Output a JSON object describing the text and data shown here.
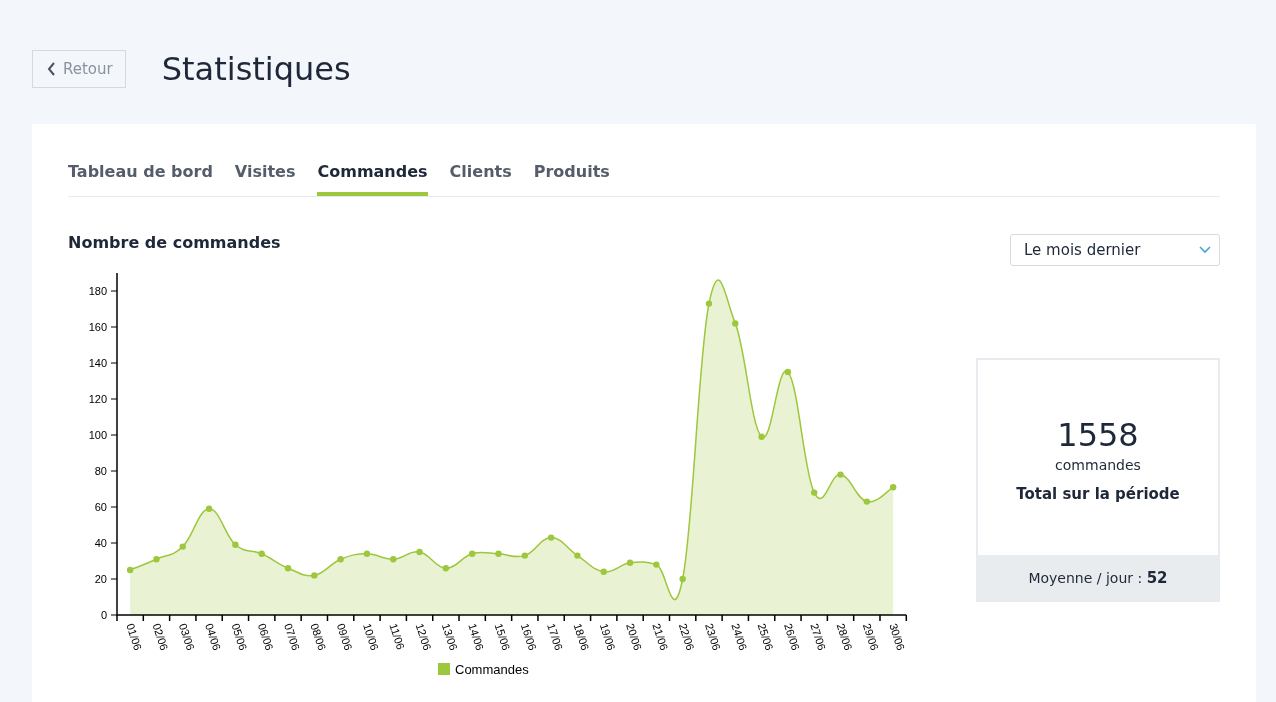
{
  "header": {
    "back_button": "Retour",
    "title": "Statistiques"
  },
  "tabs": [
    {
      "label": "Tableau de bord",
      "selected": false
    },
    {
      "label": "Visites",
      "selected": false
    },
    {
      "label": "Commandes",
      "selected": true
    },
    {
      "label": "Clients",
      "selected": false
    },
    {
      "label": "Produits",
      "selected": false
    }
  ],
  "section_title": "Nombre de commandes",
  "period_select": {
    "value": "Le mois dernier"
  },
  "chart_data": {
    "type": "area",
    "categories": [
      "01/06",
      "02/06",
      "03/06",
      "04/06",
      "05/06",
      "06/06",
      "07/06",
      "08/06",
      "09/06",
      "10/06",
      "11/06",
      "12/06",
      "13/06",
      "14/06",
      "15/06",
      "16/06",
      "17/06",
      "18/06",
      "19/06",
      "20/06",
      "21/06",
      "22/06",
      "23/06",
      "24/06",
      "25/06",
      "26/06",
      "27/06",
      "28/06",
      "29/06",
      "30/06"
    ],
    "series": [
      {
        "name": "Commandes",
        "color": "#9dc73c",
        "values": [
          25,
          31,
          38,
          59,
          39,
          34,
          26,
          22,
          31,
          34,
          31,
          35,
          26,
          34,
          34,
          33,
          43,
          33,
          24,
          29,
          28,
          20,
          173,
          162,
          99,
          135,
          68,
          78,
          63,
          71
        ]
      }
    ],
    "ylim": [
      0,
      190
    ],
    "yticks": [
      0,
      20,
      40,
      60,
      80,
      100,
      120,
      140,
      160,
      180
    ]
  },
  "summary": {
    "total": "1558",
    "unit": "commandes",
    "caption": "Total sur la période",
    "average_label": "Moyenne / jour :",
    "average_value": "52"
  }
}
